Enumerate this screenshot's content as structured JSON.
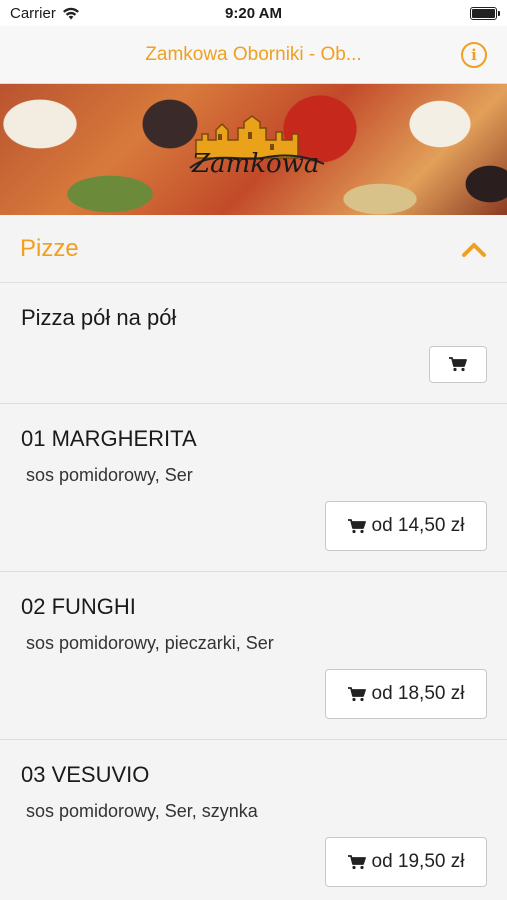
{
  "status_bar": {
    "carrier": "Carrier",
    "time": "9:20 AM"
  },
  "nav": {
    "title": "Zamkowa Oborniki - Ob...",
    "info_icon": "info-icon"
  },
  "banner": {
    "logo_text": "Zamkowa"
  },
  "section": {
    "title": "Pizze",
    "expanded": true
  },
  "items": [
    {
      "name": "Pizza pół na pół",
      "description": "",
      "price_label": ""
    },
    {
      "name": "01 MARGHERITA",
      "description": "sos pomidorowy, Ser",
      "price_label": "od 14,50 zł"
    },
    {
      "name": "02 FUNGHI",
      "description": "sos pomidorowy, pieczarki, Ser",
      "price_label": "od 18,50 zł"
    },
    {
      "name": "03 VESUVIO",
      "description": "sos pomidorowy, Ser, szynka",
      "price_label": "od 19,50 zł"
    }
  ],
  "colors": {
    "accent": "#f0a020",
    "background": "#f4f4f4"
  }
}
